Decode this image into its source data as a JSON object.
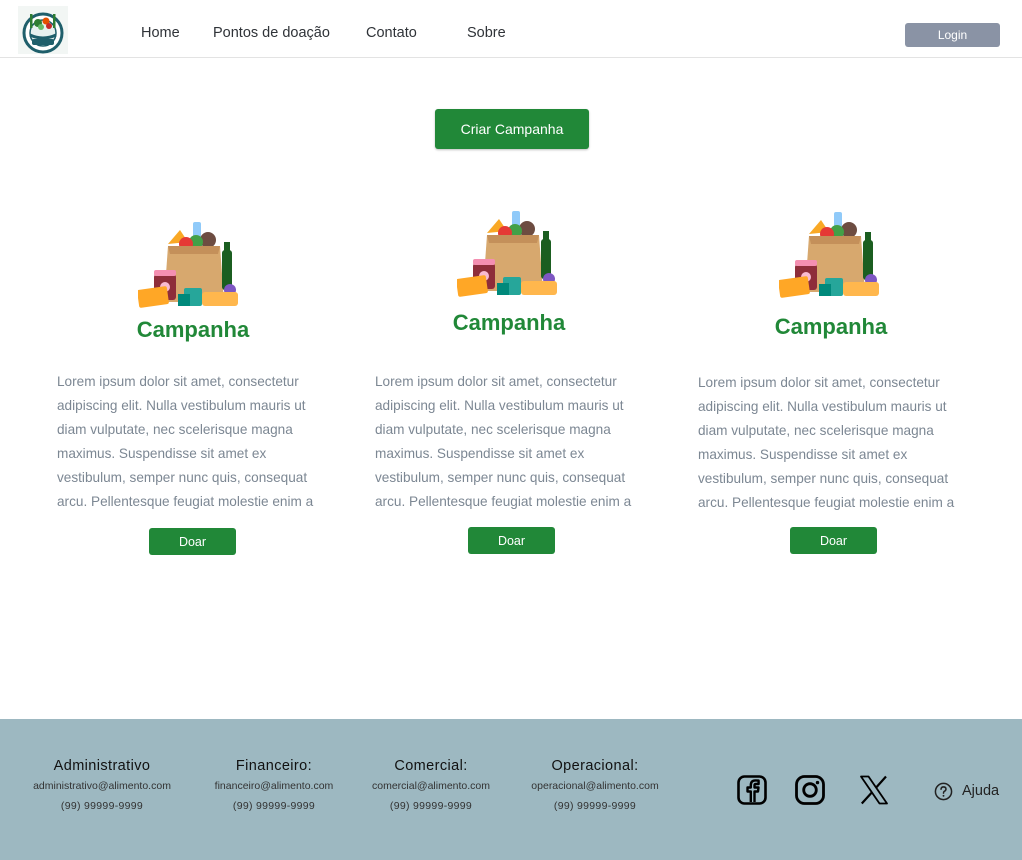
{
  "header": {
    "logo_icon": "food-plate-logo-icon",
    "nav": [
      "Home",
      "Pontos de doação",
      "Contato",
      "Sobre"
    ],
    "login_label": "Login"
  },
  "main": {
    "create_campaign_label": "Criar Campanha",
    "cards": [
      {
        "image_icon": "grocery-bag-icon",
        "title": "Campanha",
        "description": "Lorem ipsum dolor sit amet, consectetur adipiscing elit. Nulla vestibulum mauris ut diam vulputate, nec scelerisque magna maximus. Suspendisse sit amet ex vestibulum, semper nunc quis, consequat arcu. Pellentesque feugiat molestie enim a",
        "button_label": "Doar"
      },
      {
        "image_icon": "grocery-bag-icon",
        "title": "Campanha",
        "description": "Lorem ipsum dolor sit amet, consectetur adipiscing elit. Nulla vestibulum mauris ut diam vulputate, nec scelerisque magna maximus. Suspendisse sit amet ex vestibulum, semper nunc quis, consequat arcu. Pellentesque feugiat molestie enim a",
        "button_label": "Doar"
      },
      {
        "image_icon": "grocery-bag-icon",
        "title": "Campanha",
        "description": "Lorem ipsum dolor sit amet, consectetur adipiscing elit. Nulla vestibulum mauris ut diam vulputate, nec scelerisque magna maximus. Suspendisse sit amet ex vestibulum, semper nunc quis, consequat arcu. Pellentesque feugiat molestie enim a",
        "button_label": "Doar"
      }
    ]
  },
  "footer": {
    "contacts": [
      {
        "heading": "Administrativo",
        "email": "administrativo@alimento.com",
        "phone": "(99) 99999-9999"
      },
      {
        "heading": "Financeiro:",
        "email": "financeiro@alimento.com",
        "phone": "(99) 99999-9999"
      },
      {
        "heading": "Comercial:",
        "email": "comercial@alimento.com",
        "phone": "(99) 99999-9999"
      },
      {
        "heading": "Operacional:",
        "email": "operacional@alimento.com",
        "phone": "(99) 99999-9999"
      }
    ],
    "social_icons": [
      "facebook-icon",
      "instagram-icon",
      "x-twitter-icon"
    ],
    "help_label": "Ajuda"
  },
  "colors": {
    "primary_green": "#218838",
    "login_gray": "#8a93a5",
    "footer_bg": "#9db8c1",
    "text_muted": "#7c8793"
  }
}
